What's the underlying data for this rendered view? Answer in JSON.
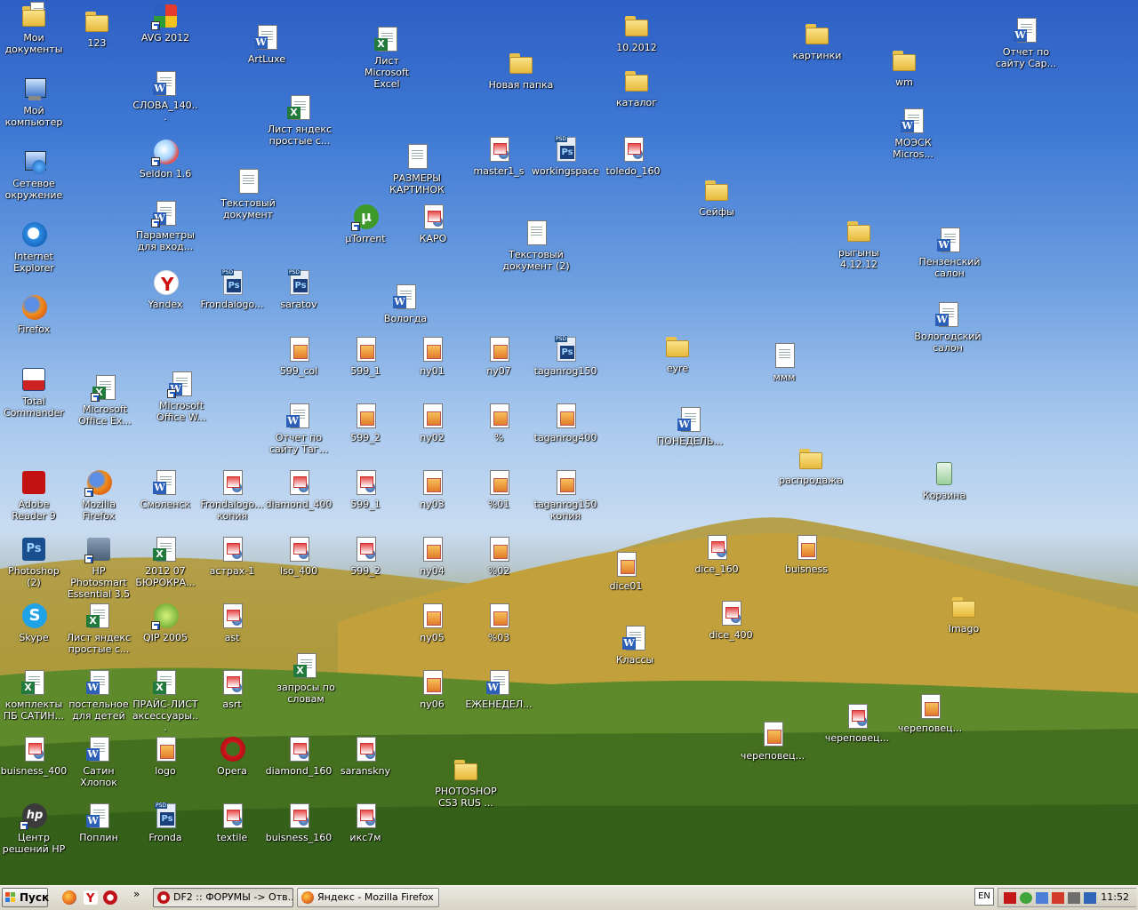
{
  "taskbar": {
    "start_label": "Пуск",
    "chevron": "»",
    "quicklaunch": [
      {
        "name": "firefox-icon",
        "color": "#e86a1c"
      },
      {
        "name": "yandex-icon",
        "color": "#cc1111"
      },
      {
        "name": "opera-icon",
        "color": "#c0141b"
      }
    ],
    "windows": [
      {
        "label": "DF2 :: ФОРУМЫ -> Отв...",
        "icon": "opera-icon",
        "color": "#c0141b",
        "active": true
      },
      {
        "label": "Яндекс - Mozilla Firefox",
        "icon": "firefox-icon",
        "color": "#e86a1c",
        "active": false
      }
    ],
    "lang": "EN",
    "clock": "11:52"
  },
  "desktop": {
    "icons": [
      {
        "name": "my-documents",
        "label": "Мои документы",
        "type": "mydocs"
      },
      {
        "name": "123",
        "label": "123",
        "type": "folder"
      },
      {
        "name": "avg-2012",
        "label": "AVG 2012",
        "type": "avg",
        "shortcut": true
      },
      {
        "name": "artluxe",
        "label": "ArtLuxe",
        "type": "word"
      },
      {
        "name": "excel-sheet",
        "label": "Лист Microsoft Excel",
        "type": "excel"
      },
      {
        "name": "new-folder",
        "label": "Новая папка",
        "type": "folder"
      },
      {
        "name": "folder-10-2012",
        "label": "10.2012",
        "type": "folder"
      },
      {
        "name": "katalog",
        "label": "каталог",
        "type": "folder"
      },
      {
        "name": "kartinki",
        "label": "картинки",
        "type": "folder"
      },
      {
        "name": "wm",
        "label": "wm",
        "type": "folder"
      },
      {
        "name": "report-sar",
        "label": "Отчет по сайту Сар...",
        "type": "word"
      },
      {
        "name": "my-computer",
        "label": "Мой компьютер",
        "type": "computer"
      },
      {
        "name": "slova",
        "label": "СЛОВА_140...",
        "type": "word"
      },
      {
        "name": "yandex-list-1",
        "label": "Лист яндекс простые с...",
        "type": "excel"
      },
      {
        "name": "moesk",
        "label": "МОЭСК Micros...",
        "type": "word"
      },
      {
        "name": "seldon",
        "label": "Seldon 1.6",
        "type": "seldon",
        "shortcut": true
      },
      {
        "name": "sizes",
        "label": "РАЗМЕРЫ КАРТИНОК",
        "type": "txt"
      },
      {
        "name": "master1",
        "label": "master1_s",
        "type": "pic"
      },
      {
        "name": "workingspace",
        "label": "workingspace",
        "type": "psd"
      },
      {
        "name": "toledo",
        "label": "toledo_160",
        "type": "pic"
      },
      {
        "name": "network",
        "label": "Сетевое окружение",
        "type": "network"
      },
      {
        "name": "textdoc",
        "label": "Текстовый документ",
        "type": "txt"
      },
      {
        "name": "safes",
        "label": "Сейфы",
        "type": "folder"
      },
      {
        "name": "utorrent",
        "label": "µTorrent",
        "type": "utorrent",
        "shortcut": true
      },
      {
        "name": "karo",
        "label": "КАРО",
        "type": "pic"
      },
      {
        "name": "textdoc-2",
        "label": "Текстовый документ (2)",
        "type": "txt"
      },
      {
        "name": "rygyny",
        "label": "рыгыны 4.12.12",
        "type": "folder"
      },
      {
        "name": "penza",
        "label": "Пензенский салон",
        "type": "word"
      },
      {
        "name": "ie",
        "label": "Internet Explorer",
        "type": "ie"
      },
      {
        "name": "params",
        "label": "Параметры для вход...",
        "type": "word",
        "shortcut": true
      },
      {
        "name": "yandex",
        "label": "Yandex",
        "type": "yandex"
      },
      {
        "name": "frondalogo-psd",
        "label": "Frondalogo...",
        "type": "psd"
      },
      {
        "name": "saratov",
        "label": "saratov",
        "type": "psd"
      },
      {
        "name": "vologda",
        "label": "Вологда",
        "type": "word"
      },
      {
        "name": "vologda-salon",
        "label": "Вологодский салон",
        "type": "word"
      },
      {
        "name": "firefox",
        "label": "Firefox",
        "type": "firefox"
      },
      {
        "name": "599-col",
        "label": "599_col",
        "type": "img"
      },
      {
        "name": "599-1a",
        "label": "599_1",
        "type": "img"
      },
      {
        "name": "ny01",
        "label": "ny01",
        "type": "img"
      },
      {
        "name": "ny07",
        "label": "ny07",
        "type": "img"
      },
      {
        "name": "taganrog150",
        "label": "taganrog150",
        "type": "psd"
      },
      {
        "name": "eyre",
        "label": "eyre",
        "type": "folder"
      },
      {
        "name": "mmm",
        "label": "ммм",
        "type": "txt"
      },
      {
        "name": "total-commander",
        "label": "Total Commander",
        "type": "tc"
      },
      {
        "name": "ms-excel",
        "label": "Microsoft Office Ex...",
        "type": "excel",
        "shortcut": true
      },
      {
        "name": "ms-word",
        "label": "Microsoft Office W...",
        "type": "word",
        "shortcut": true
      },
      {
        "name": "report-tag",
        "label": "Отчет по сайту Таг...",
        "type": "word"
      },
      {
        "name": "599-2a",
        "label": "599_2",
        "type": "img"
      },
      {
        "name": "ny02",
        "label": "ny02",
        "type": "img"
      },
      {
        "name": "percent",
        "label": "%",
        "type": "img"
      },
      {
        "name": "taganrog400",
        "label": "taganrog400",
        "type": "img"
      },
      {
        "name": "monday",
        "label": "ПОНЕДЕЛЬ...",
        "type": "word"
      },
      {
        "name": "sale",
        "label": "распродажа",
        "type": "folder"
      },
      {
        "name": "recycle",
        "label": "Корзина",
        "type": "recycle"
      },
      {
        "name": "adobe-reader",
        "label": "Adobe Reader 9",
        "type": "adobe"
      },
      {
        "name": "mozilla-firefox",
        "label": "Mozilla Firefox",
        "type": "firefox",
        "shortcut": true
      },
      {
        "name": "smolensk",
        "label": "Смоленск",
        "type": "word"
      },
      {
        "name": "frondalogo-copy",
        "label": "Frondalogo... копия",
        "type": "pic"
      },
      {
        "name": "diamond400",
        "label": "diamond_400",
        "type": "pic"
      },
      {
        "name": "599-1b",
        "label": "599_1",
        "type": "pic"
      },
      {
        "name": "ny03",
        "label": "ny03",
        "type": "img"
      },
      {
        "name": "pct01",
        "label": "%01",
        "type": "img"
      },
      {
        "name": "taganrog150-copy",
        "label": "taganrog150 копия",
        "type": "img"
      },
      {
        "name": "photoshop2",
        "label": "Photoshop (2)",
        "type": "ps"
      },
      {
        "name": "hp-photosmart",
        "label": "HP Photosmart Essential 3.5",
        "type": "hpphoto",
        "shortcut": true
      },
      {
        "name": "bureaucracy",
        "label": "2012 07 БЮРОКРА...",
        "type": "excel"
      },
      {
        "name": "astrakh1",
        "label": "астрах-1",
        "type": "pic"
      },
      {
        "name": "iso400",
        "label": "Iso_400",
        "type": "pic"
      },
      {
        "name": "599-2b",
        "label": "599_2",
        "type": "pic"
      },
      {
        "name": "ny04",
        "label": "ny04",
        "type": "img"
      },
      {
        "name": "pct02",
        "label": "%02",
        "type": "img"
      },
      {
        "name": "dice01",
        "label": "dice01",
        "type": "img"
      },
      {
        "name": "dice160",
        "label": "dice_160",
        "type": "pic"
      },
      {
        "name": "buisness",
        "label": "buisness",
        "type": "img"
      },
      {
        "name": "skype",
        "label": "Skype",
        "type": "skype"
      },
      {
        "name": "yandex-list-2",
        "label": "Лист яндекс простые с...",
        "type": "excel"
      },
      {
        "name": "qip",
        "label": "QIP 2005",
        "type": "qip",
        "shortcut": true
      },
      {
        "name": "ast",
        "label": "ast",
        "type": "pic"
      },
      {
        "name": "ny05",
        "label": "ny05",
        "type": "img"
      },
      {
        "name": "pct03",
        "label": "%03",
        "type": "img"
      },
      {
        "name": "klassy",
        "label": "Классы",
        "type": "word"
      },
      {
        "name": "dice400",
        "label": "dice_400",
        "type": "pic"
      },
      {
        "name": "imago",
        "label": "Imago",
        "type": "folder"
      },
      {
        "name": "kits",
        "label": "комплекты ПБ САТИН...",
        "type": "excel"
      },
      {
        "name": "kids-bedding",
        "label": "постельное для детей",
        "type": "word"
      },
      {
        "name": "pricelist",
        "label": "ПРАЙС-ЛИСТ аксессуары...",
        "type": "excel"
      },
      {
        "name": "asrt",
        "label": "asrt",
        "type": "pic"
      },
      {
        "name": "queries",
        "label": "запросы по словам",
        "type": "excel"
      },
      {
        "name": "ny06",
        "label": "ny06",
        "type": "img"
      },
      {
        "name": "weekly",
        "label": "ЕЖЕНЕДЕЛ...",
        "type": "word"
      },
      {
        "name": "cherepovets-1",
        "label": "череповец...",
        "type": "img"
      },
      {
        "name": "cherepovets-2",
        "label": "череповец...",
        "type": "pic"
      },
      {
        "name": "cherepovets-3",
        "label": "череповец...",
        "type": "img"
      },
      {
        "name": "buisness400",
        "label": "buisness_400",
        "type": "pic"
      },
      {
        "name": "satin",
        "label": "Сатин Хлопок",
        "type": "word"
      },
      {
        "name": "logo",
        "label": "logo",
        "type": "img"
      },
      {
        "name": "opera",
        "label": "Opera",
        "type": "opera"
      },
      {
        "name": "diamond160",
        "label": "diamond_160",
        "type": "pic"
      },
      {
        "name": "saransky",
        "label": "saranskny",
        "type": "pic"
      },
      {
        "name": "photoshop-cs3",
        "label": "PHOTOSHOP CS3 RUS ...",
        "type": "folder"
      },
      {
        "name": "hp-center",
        "label": "Центр решений HP",
        "type": "hp",
        "shortcut": true
      },
      {
        "name": "poplin",
        "label": "Поплин",
        "type": "word"
      },
      {
        "name": "fronda",
        "label": "Fronda",
        "type": "psd"
      },
      {
        "name": "textile",
        "label": "textile",
        "type": "pic"
      },
      {
        "name": "buisness160",
        "label": "buisness_160",
        "type": "pic"
      },
      {
        "name": "iks7m",
        "label": "икс7м",
        "type": "pic"
      }
    ]
  }
}
